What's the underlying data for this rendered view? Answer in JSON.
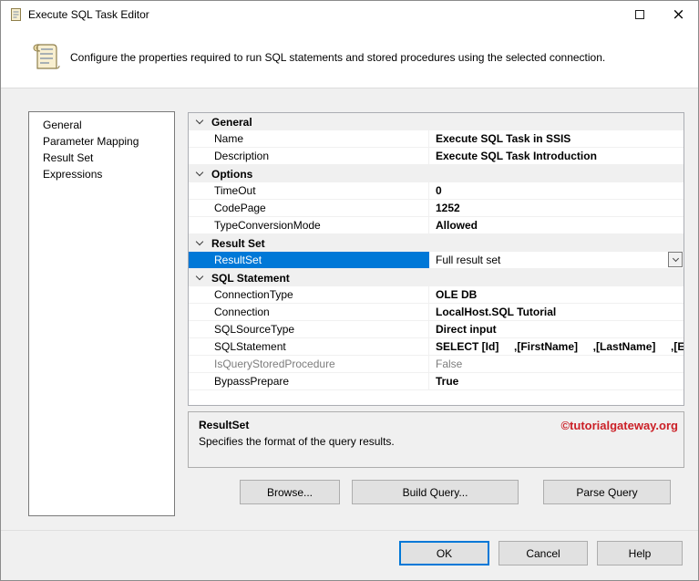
{
  "window": {
    "title": "Execute SQL Task Editor"
  },
  "icons": {
    "close": "×"
  },
  "header": {
    "description": "Configure the properties required to run SQL statements and stored procedures using the selected connection."
  },
  "sidebar": {
    "items": [
      "General",
      "Parameter Mapping",
      "Result Set",
      "Expressions"
    ]
  },
  "grid": {
    "rows": [
      {
        "type": "category",
        "label": "General"
      },
      {
        "type": "property",
        "name": "Name",
        "value": "Execute SQL Task in SSIS",
        "bold": true
      },
      {
        "type": "property",
        "name": "Description",
        "value": "Execute SQL Task Introduction",
        "bold": true
      },
      {
        "type": "category",
        "label": "Options"
      },
      {
        "type": "property",
        "name": "TimeOut",
        "value": "0",
        "bold": true
      },
      {
        "type": "property",
        "name": "CodePage",
        "value": "1252",
        "bold": true
      },
      {
        "type": "property",
        "name": "TypeConversionMode",
        "value": "Allowed",
        "bold": true
      },
      {
        "type": "category",
        "label": "Result Set"
      },
      {
        "type": "property",
        "name": "ResultSet",
        "value": "Full result set",
        "selected": true,
        "dropdown": true
      },
      {
        "type": "category",
        "label": "SQL Statement"
      },
      {
        "type": "property",
        "name": "ConnectionType",
        "value": "OLE DB",
        "bold": true
      },
      {
        "type": "property",
        "name": "Connection",
        "value": "LocalHost.SQL Tutorial",
        "bold": true
      },
      {
        "type": "property",
        "name": "SQLSourceType",
        "value": "Direct input",
        "bold": true
      },
      {
        "type": "property",
        "name": "SQLStatement",
        "value": "SELECT [Id]     ,[FirstName]     ,[LastName]     ,[Edu",
        "bold": true
      },
      {
        "type": "property",
        "name": "IsQueryStoredProcedure",
        "value": "False",
        "disabled": true
      },
      {
        "type": "property",
        "name": "BypassPrepare",
        "value": "True",
        "bold": true
      }
    ]
  },
  "description_panel": {
    "title": "ResultSet",
    "text": "Specifies the format of the query results.",
    "watermark": "©tutorialgateway.org"
  },
  "grid_buttons": [
    {
      "label": "Browse..."
    },
    {
      "label": "Build Query..."
    },
    {
      "label": "Parse Query"
    }
  ],
  "footer_buttons": [
    {
      "label": "OK",
      "default": true
    },
    {
      "label": "Cancel"
    },
    {
      "label": "Help"
    }
  ],
  "colors": {
    "selection": "#0078d7",
    "watermark": "#cb2027"
  }
}
